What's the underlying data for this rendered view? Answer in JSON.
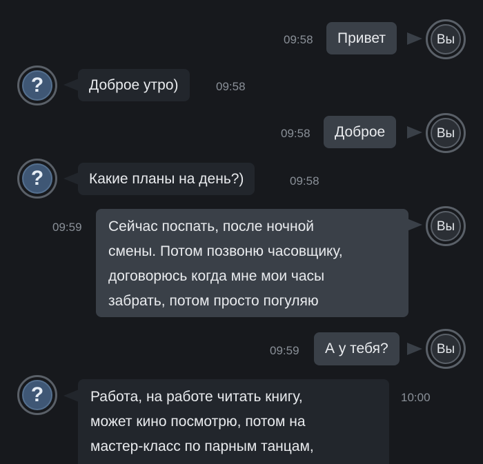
{
  "labels": {
    "unknown_avatar": "?",
    "me_avatar": "Вы"
  },
  "messages": [
    {
      "from": "me",
      "text": "Привет",
      "time": "09:58"
    },
    {
      "from": "other",
      "text": "Доброе утро)",
      "time": "09:58"
    },
    {
      "from": "me",
      "text": "Доброе",
      "time": "09:58"
    },
    {
      "from": "other",
      "text": "Какие планы на день?)",
      "time": "09:58"
    },
    {
      "from": "me",
      "lines": [
        "Сейчас поспать, после ночной",
        "смены. Потом позвоню часовщику,",
        "договорюсь когда мне мои часы",
        "забрать, потом просто погуляю"
      ],
      "time": "09:59"
    },
    {
      "from": "me",
      "text": "А у тебя?",
      "time": "09:59"
    },
    {
      "from": "other",
      "lines": [
        "Работа, на работе читать книгу,",
        "может кино посмотрю, потом на",
        "мастер-класс по парным танцам,"
      ],
      "time": "10:00"
    }
  ],
  "colors": {
    "background": "#17191d",
    "incoming_bubble": "#22262c",
    "outgoing_bubble": "#3a4048",
    "unknown_avatar": "#3f5775"
  }
}
